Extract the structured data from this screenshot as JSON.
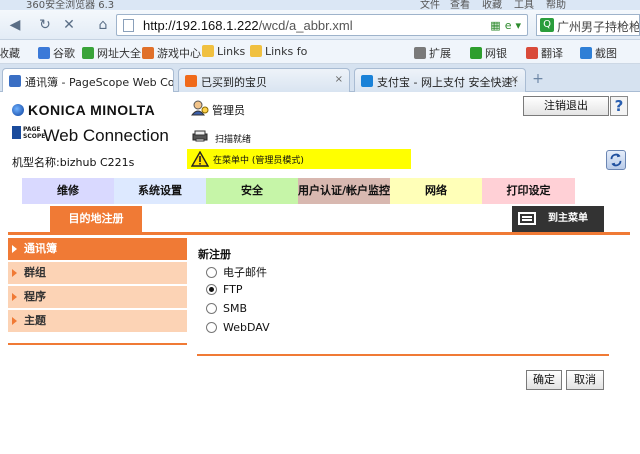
{
  "browser": {
    "title": "360安全浏览器 6.3",
    "menu": [
      "文件",
      "查看",
      "收藏",
      "工具",
      "帮助"
    ],
    "url_host": "http://192.168.1.222",
    "url_path": "/wcd/a_abbr.xml",
    "search_text": "广州男子持枪枪",
    "favorites": [
      {
        "label": "收藏",
        "color": "#f2b634"
      },
      {
        "label": "谷歌",
        "color": "#3b79d8"
      },
      {
        "label": "网址大全",
        "color": "#39a339"
      },
      {
        "label": "游戏中心",
        "color": "#e0702a"
      },
      {
        "label": "Links",
        "color": "#f0c040"
      },
      {
        "label": "Links fo",
        "color": "#f0c040"
      },
      {
        "label": "扩展",
        "color": "#7a7a7a"
      },
      {
        "label": "网银",
        "color": "#2e9e2e"
      },
      {
        "label": "翻译",
        "color": "#d94a3a"
      },
      {
        "label": "截图",
        "color": "#2f7fd6"
      }
    ],
    "tabs": [
      {
        "label": "通讯簿 - PageScope Web Co",
        "color": "#3a6fc4",
        "active": true
      },
      {
        "label": "已买到的宝贝",
        "color": "#f06a1a",
        "active": false
      },
      {
        "label": "支付宝 - 网上支付 安全快速！",
        "color": "#1a82d8",
        "active": false
      }
    ],
    "tab_close": "×",
    "tab_add": "+"
  },
  "header": {
    "brand": "KONICA MINOLTA",
    "pagescope": [
      "PAGE",
      "SCOPE"
    ],
    "product": "Web Connection",
    "model": "机型名称:bizhub C221s",
    "admin_label": "管理员",
    "logout": "注销退出",
    "help": "?",
    "status": "扫描就绪",
    "mode": "在菜单中 (管理员模式)"
  },
  "main_tabs": [
    {
      "label": "维修",
      "color": "#d9d9ff"
    },
    {
      "label": "系统设置",
      "color": "#dde9ff"
    },
    {
      "label": "安全",
      "color": "#c6f5a8"
    },
    {
      "label": "用户认证/帐户监控",
      "color": "#d8b8b0"
    },
    {
      "label": "网络",
      "color": "#ffffb8"
    },
    {
      "label": "打印设定",
      "color": "#ffd0d6"
    }
  ],
  "sub_tab": "目的地注册",
  "home_button": "到主菜单",
  "side_nav": [
    {
      "label": "通讯簿",
      "active": true
    },
    {
      "label": "群组",
      "active": false
    },
    {
      "label": "程序",
      "active": false
    },
    {
      "label": "主题",
      "active": false
    }
  ],
  "form": {
    "title": "新注册",
    "options": [
      {
        "label": "电子邮件",
        "checked": false
      },
      {
        "label": "FTP",
        "checked": true
      },
      {
        "label": "SMB",
        "checked": false
      },
      {
        "label": "WebDAV",
        "checked": false
      }
    ],
    "ok": "确定",
    "cancel": "取消"
  }
}
